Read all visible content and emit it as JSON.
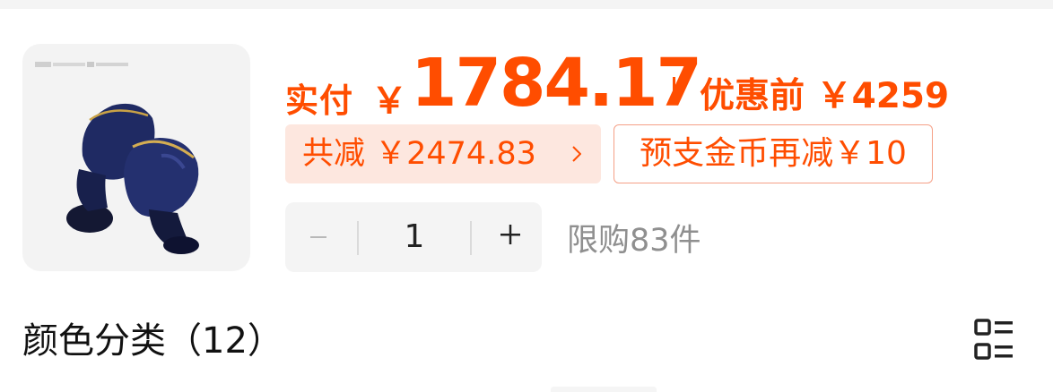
{
  "product": {
    "image_icon": "earbuds-product-image"
  },
  "price": {
    "label": "实付",
    "currency": "￥",
    "value": "1784.17",
    "original": "优惠前 ￥4259",
    "accent_color": "#ff4d00"
  },
  "discount": {
    "total_text": "共减 ￥2474.83",
    "coin_text": "预支金币再减￥10"
  },
  "quantity": {
    "value": "1",
    "limit_text": "限购83件"
  },
  "section": {
    "title": "颜色分类（12）",
    "toggle_icon": "list-view-icon"
  }
}
